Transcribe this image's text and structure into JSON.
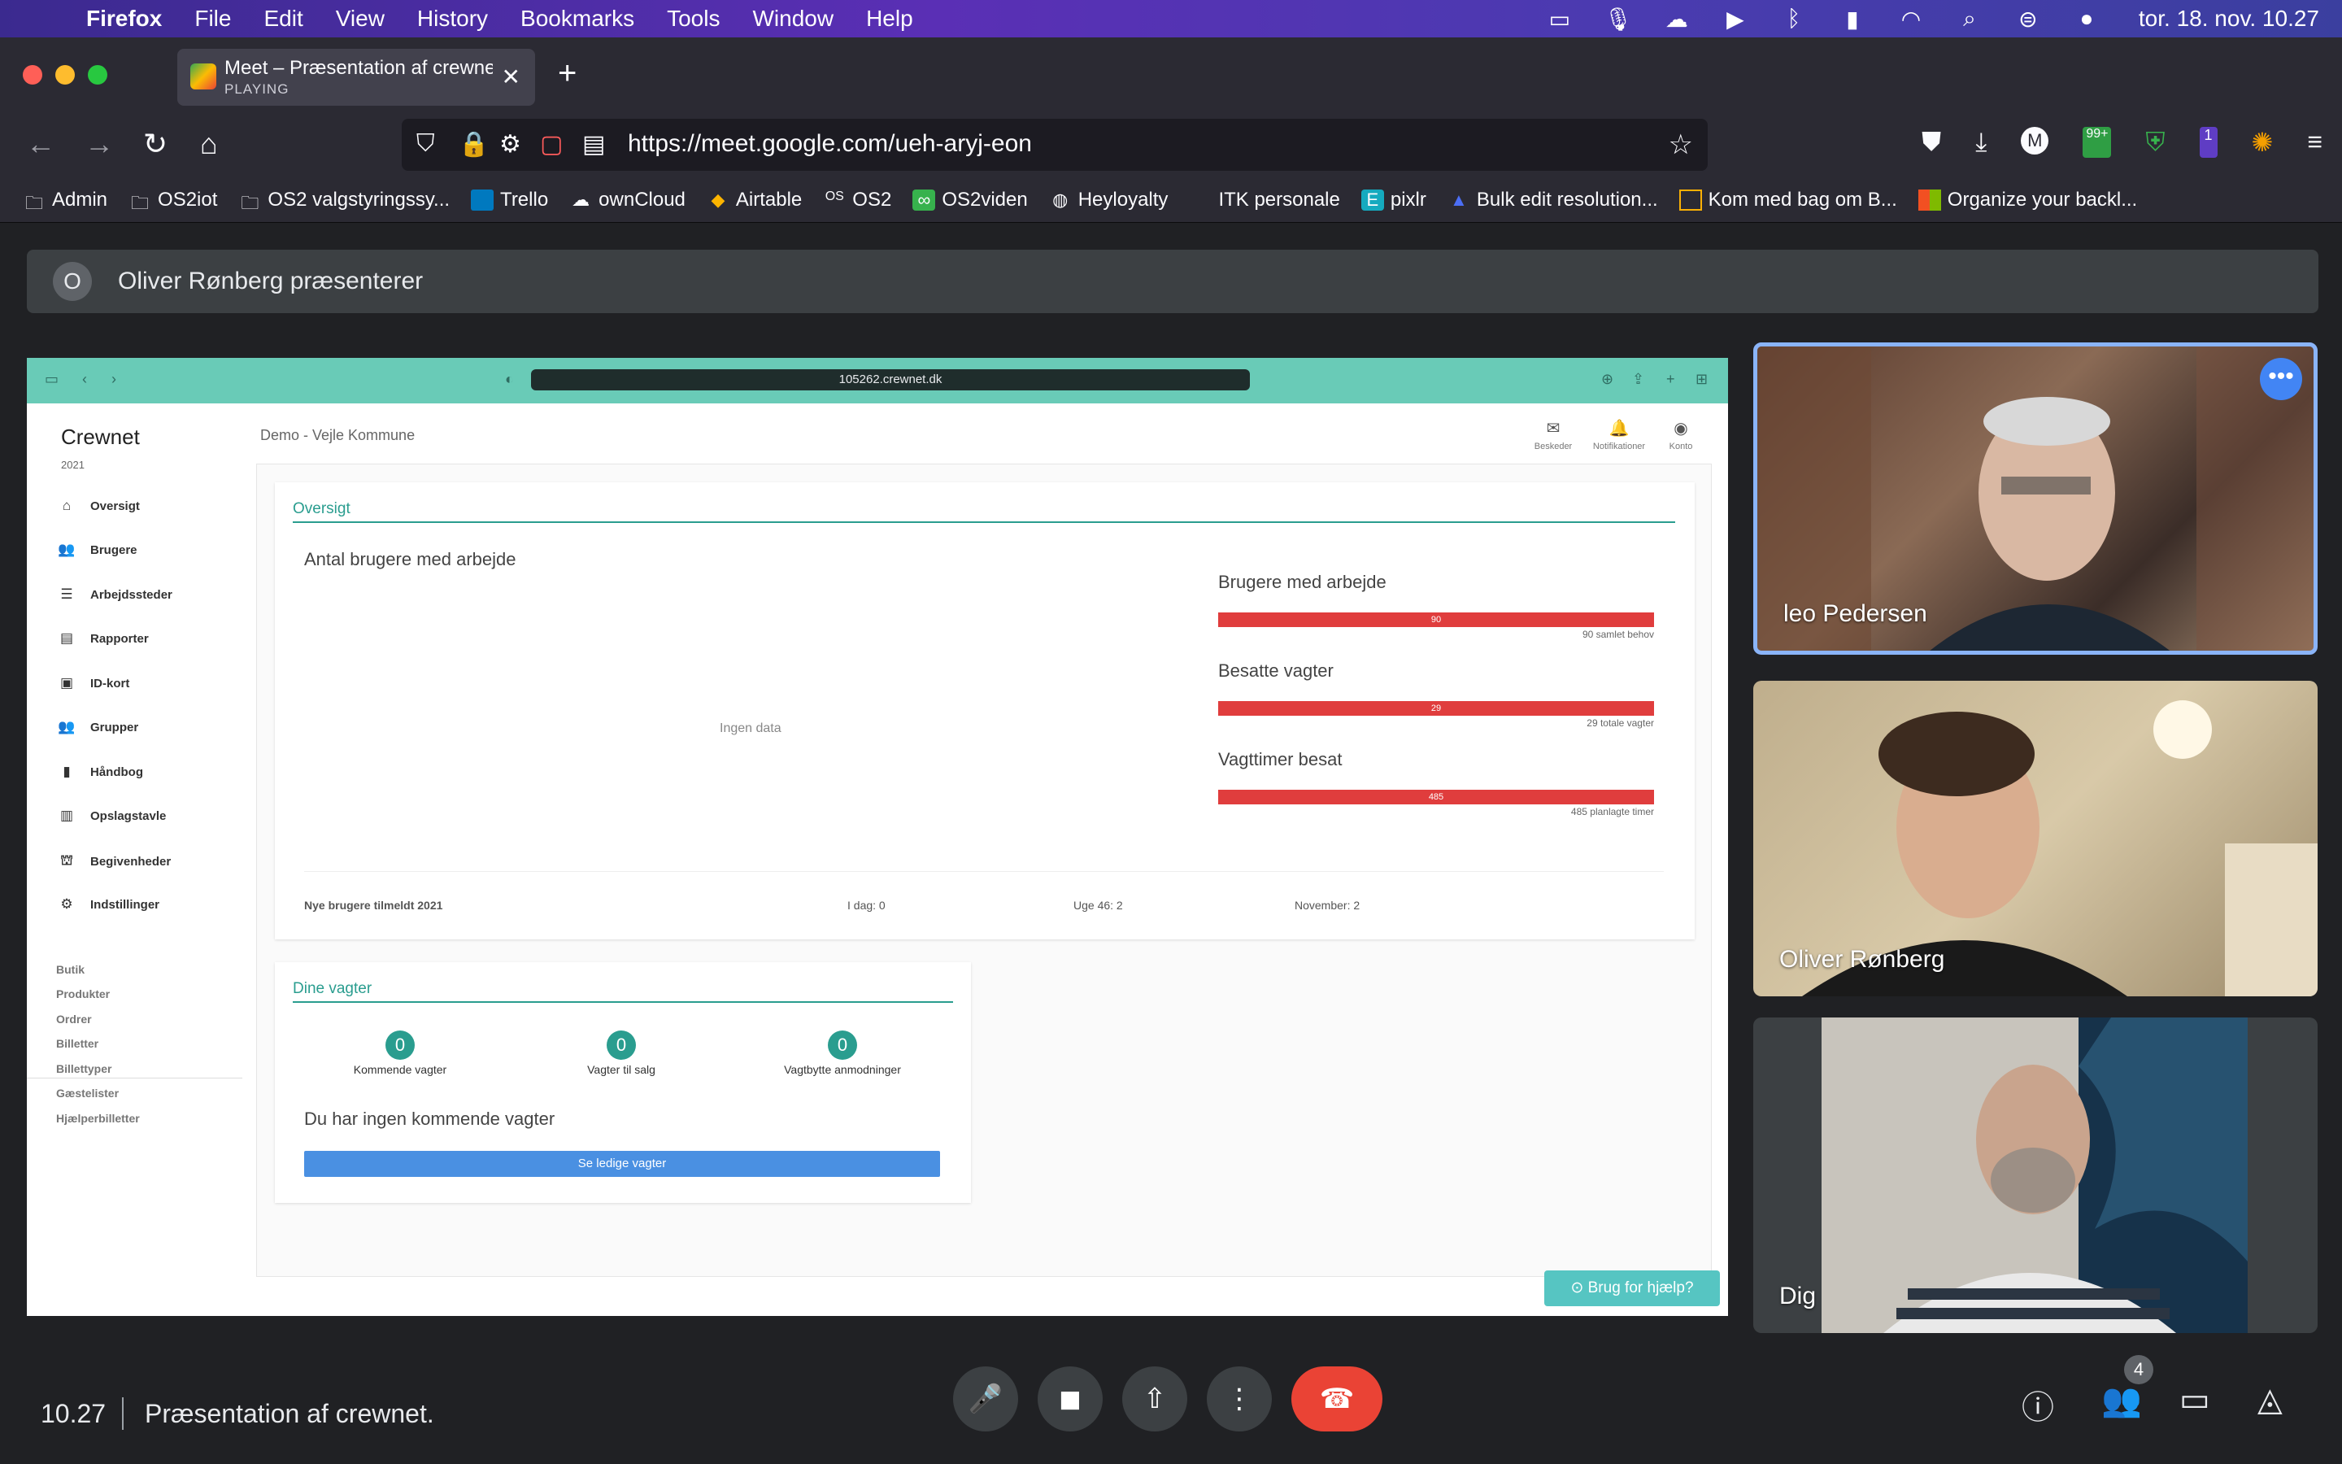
{
  "menubar": {
    "app": "Firefox",
    "items": [
      "File",
      "Edit",
      "View",
      "History",
      "Bookmarks",
      "Tools",
      "Window",
      "Help"
    ],
    "clock": "tor. 18. nov. 10.27"
  },
  "browser": {
    "tab_title": "Meet – Præsentation af crewnet.",
    "tab_status": "PLAYING",
    "url": "https://meet.google.com/ueh-aryj-eon",
    "extension_badge": "99+",
    "profile_initial": "M",
    "notif_count": "1"
  },
  "bookmarks": [
    "Admin",
    "OS2iot",
    "OS2 valgstyringssy...",
    "Trello",
    "ownCloud",
    "Airtable",
    "OS2",
    "OS2viden",
    "Heyloyalty",
    "ITK personale",
    "pixlr",
    "Bulk edit resolution...",
    "Kom med bag om B...",
    "Organize your backl..."
  ],
  "meet": {
    "presenter_initial": "O",
    "presenter_text": "Oliver Rønberg præsenterer",
    "time": "10.27",
    "meeting_title": "Præsentation af crewnet.",
    "participant_count": "4",
    "tiles": [
      {
        "name": "leo Pedersen"
      },
      {
        "name": "Oliver Rønberg"
      },
      {
        "name": "Dig"
      }
    ]
  },
  "shared": {
    "url": "105262.crewnet.dk",
    "brand": "Crewnet",
    "year": "2021",
    "org": "Demo - Vejle Kommune",
    "top_icons": [
      "Beskeder",
      "Notifikationer",
      "Konto"
    ],
    "nav": [
      "Oversigt",
      "Brugere",
      "Arbejdssteder",
      "Rapporter",
      "ID-kort",
      "Grupper",
      "Håndbog",
      "Opslagstavle",
      "Begivenheder",
      "Indstillinger"
    ],
    "shop": [
      "Butik",
      "Produkter",
      "Ordrer",
      "Billetter",
      "Billettyper",
      "Gæstelister",
      "Hjælperbilletter"
    ],
    "overview": {
      "title": "Oversigt",
      "chart_title": "Antal brugere med arbejde",
      "no_data": "Ingen data",
      "stats": [
        {
          "label": "Brugere med arbejde",
          "value": "90",
          "note": "90 samlet behov"
        },
        {
          "label": "Besatte vagter",
          "value": "29",
          "note": "29 totale vagter"
        },
        {
          "label": "Vagttimer besat",
          "value": "485",
          "note": "485 planlagte timer"
        }
      ],
      "new_users_label": "Nye brugere tilmeldt 2021",
      "today": "I dag: 0",
      "week": "Uge 46: 2",
      "month": "November: 2"
    },
    "shifts": {
      "title": "Dine vagter",
      "counters": [
        {
          "value": "0",
          "label": "Kommende vagter"
        },
        {
          "value": "0",
          "label": "Vagter til salg"
        },
        {
          "value": "0",
          "label": "Vagtbytte anmodninger"
        }
      ],
      "none_text": "Du har ingen kommende vagter",
      "button": "Se ledige vagter"
    },
    "help_button": "⊙ Brug for hjælp?"
  }
}
